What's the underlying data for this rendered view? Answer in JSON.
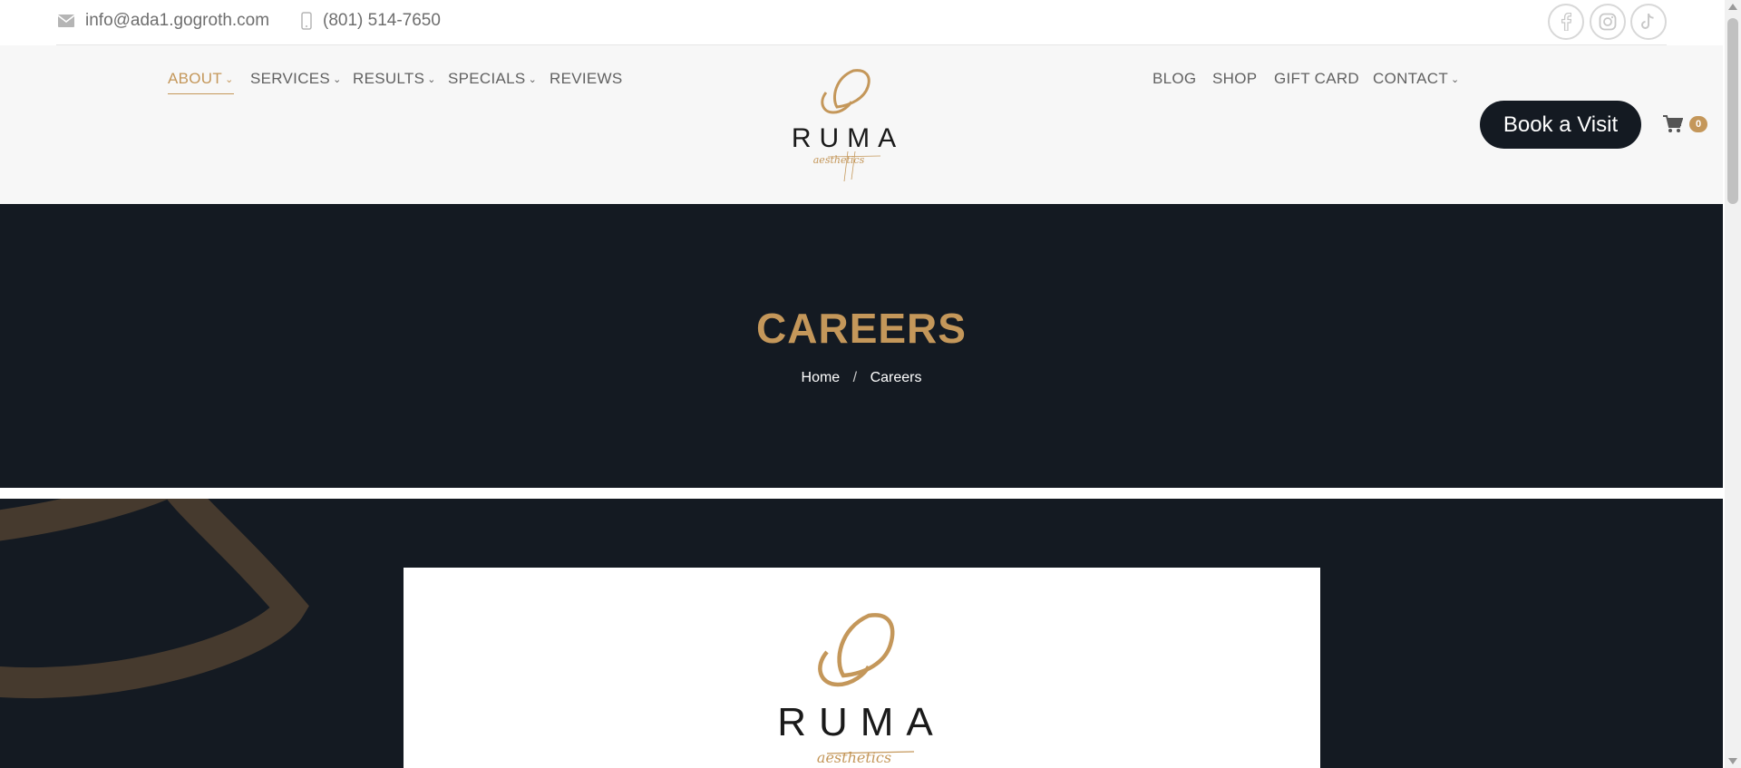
{
  "topbar": {
    "email": "info@ada1.gogroth.com",
    "phone": "(801) 514-7650",
    "email_icon": "mail-icon",
    "phone_icon": "phone-icon",
    "social_icons": [
      "facebook-icon",
      "instagram-icon",
      "tiktok-icon"
    ]
  },
  "nav": {
    "left": [
      {
        "label": "ABOUT",
        "has_dropdown": true,
        "active": true
      },
      {
        "label": "SERVICES",
        "has_dropdown": true
      },
      {
        "label": "RESULTS",
        "has_dropdown": true
      },
      {
        "label": "SPECIALS",
        "has_dropdown": true
      },
      {
        "label": "REVIEWS",
        "has_dropdown": false
      }
    ],
    "right": [
      {
        "label": "BLOG",
        "has_dropdown": false
      },
      {
        "label": "SHOP",
        "has_dropdown": false
      },
      {
        "label": "GIFT CARD",
        "has_dropdown": false
      },
      {
        "label": "CONTACT",
        "has_dropdown": true
      }
    ],
    "chevron": "⌄"
  },
  "logo": {
    "name": "RUMA",
    "tagline": "aesthetics"
  },
  "book_button": {
    "label": "Book a Visit"
  },
  "cart": {
    "icon": "cart-icon",
    "count": "0"
  },
  "hero": {
    "title": "CAREERS",
    "breadcrumb": {
      "home": "Home",
      "separator": "/",
      "current": "Careers"
    }
  },
  "colors": {
    "accent": "#c4975a",
    "dark": "#141a22",
    "header_bg": "#f7f7f7"
  }
}
